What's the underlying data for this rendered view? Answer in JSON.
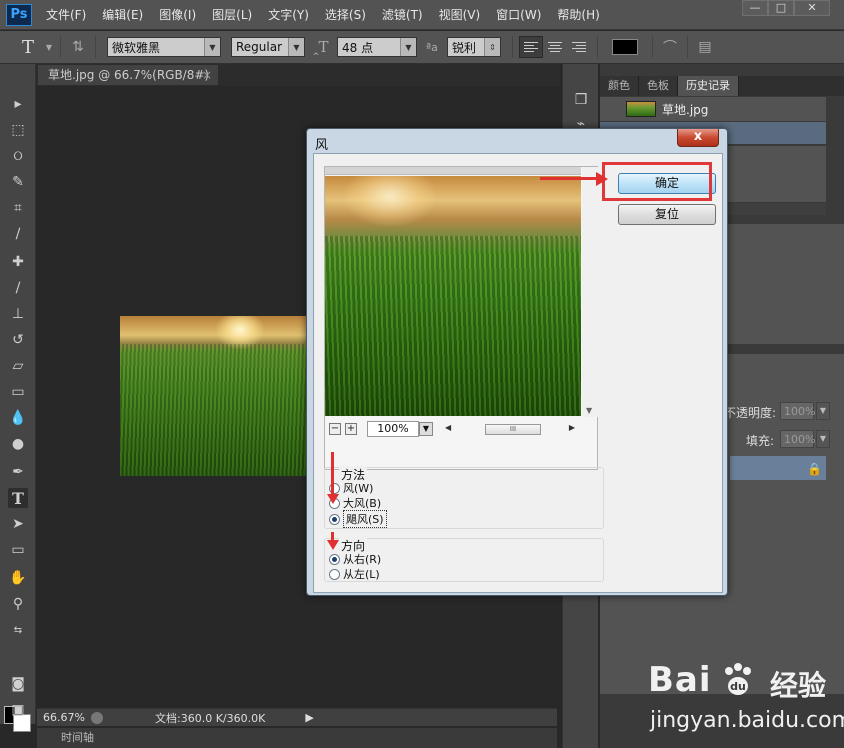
{
  "app": {
    "logo": "Ps"
  },
  "menu": [
    "文件(F)",
    "编辑(E)",
    "图像(I)",
    "图层(L)",
    "文字(Y)",
    "选择(S)",
    "滤镜(T)",
    "视图(V)",
    "窗口(W)",
    "帮助(H)"
  ],
  "window_controls": {
    "minimize": "—",
    "restore": "□",
    "close": "✕"
  },
  "options": {
    "font_family": "微软雅黑",
    "font_style": "Regular",
    "font_size": "48 点",
    "aa_icon": "ªa",
    "anti_alias": "锐利"
  },
  "document_tab": {
    "title": "草地.jpg @ 66.7%(RGB/8#)",
    "close": "×"
  },
  "status": {
    "zoom": "66.67%",
    "doc_info": "文档:360.0 K/360.0K",
    "timeline": "时间轴"
  },
  "panels": {
    "tabs": [
      "颜色",
      "色板",
      "历史记录"
    ],
    "active_tab": "历史记录",
    "history_item": "草地.jpg",
    "opacity_label": "不透明度:",
    "opacity_value": "100%",
    "fill_label": "填充:",
    "fill_value": "100%"
  },
  "dialog": {
    "title": "风",
    "close": "x",
    "ok_label": "确定",
    "reset_label": "复位",
    "zoom_value": "100%",
    "zoom_out": "−",
    "zoom_in": "+",
    "method": {
      "title": "方法",
      "options": [
        "风(W)",
        "大风(B)",
        "飓风(S)"
      ],
      "selected_index": 2
    },
    "direction": {
      "title": "方向",
      "options": [
        "从右(R)",
        "从左(L)"
      ],
      "selected_index": 0
    }
  },
  "watermark": {
    "brand": "Bai",
    "cn": "经验",
    "url": "jingyan.baidu.com"
  },
  "colors": {
    "highlight": "#e03838",
    "menu_bg": "#535353",
    "dialog_bg": "#f0f0f0"
  }
}
